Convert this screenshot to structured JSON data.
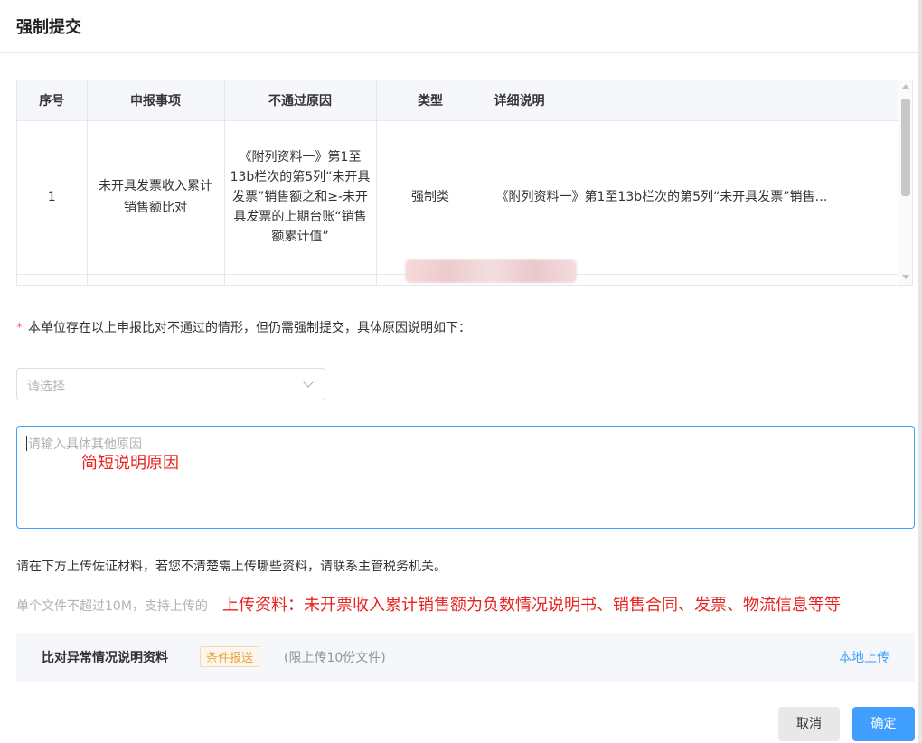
{
  "dialog": {
    "title": "强制提交"
  },
  "table": {
    "headers": [
      "序号",
      "申报事项",
      "不通过原因",
      "类型",
      "详细说明"
    ],
    "rows": [
      {
        "index": "1",
        "item": "未开具发票收入累计销售额比对",
        "reason": "《附列资料一》第1至13b栏次的第5列“未开具发票”销售额之和≥-未开具发票的上期台账“销售额累计值”",
        "type": "强制类",
        "detail": "《附列资料一》第1至13b栏次的第5列“未开具发票”销售…"
      }
    ]
  },
  "form": {
    "notice_star": "*",
    "notice": "本单位存在以上申报比对不通过的情形，但仍需强制提交，具体原因说明如下：",
    "select_placeholder": "请选择",
    "textarea_placeholder": "请输入具体其他原因",
    "upload_tip": "请在下方上传佐证材料，若您不清楚需上传哪些资料，请联系主管税务机关。",
    "size_tip": "单个文件不超过10M，支持上传的"
  },
  "annotations": {
    "short_reason": "简短说明原因",
    "upload_note": "上传资料：未开票收入累计销售额为负数情况说明书、销售合同、发票、物流信息等等"
  },
  "file_row": {
    "name": "比对异常情况说明资料",
    "badge": "条件报送",
    "limit": "(限上传10份文件)",
    "upload_link": "本地上传"
  },
  "buttons": {
    "cancel": "取消",
    "confirm": "确定"
  },
  "colors": {
    "primary": "#409eff",
    "annotation_red": "#e8231f",
    "badge_orange": "#e6a23c",
    "required_star": "#f56c6c"
  }
}
